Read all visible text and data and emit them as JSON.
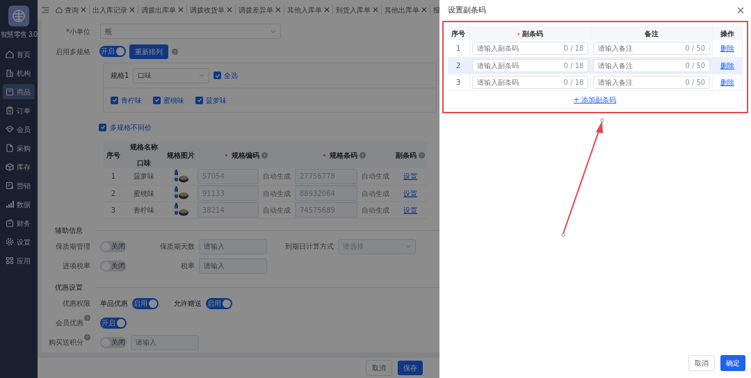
{
  "sidebar": {
    "logo_text": "智慧零售 3.0",
    "items": [
      {
        "label": "首页",
        "selected": false
      },
      {
        "label": "机构",
        "selected": false
      },
      {
        "label": "商品",
        "selected": true
      },
      {
        "label": "订单",
        "selected": false
      },
      {
        "label": "会员",
        "selected": false
      },
      {
        "label": "采购",
        "selected": false
      },
      {
        "label": "库存",
        "selected": false
      },
      {
        "label": "营销",
        "selected": false
      },
      {
        "label": "数据",
        "selected": false
      },
      {
        "label": "财务",
        "selected": false
      },
      {
        "label": "设置",
        "selected": false
      },
      {
        "label": "应用",
        "selected": false
      }
    ]
  },
  "tabs": [
    {
      "label": "查询",
      "kind": "home",
      "closable": true
    },
    {
      "label": "出入库记录",
      "kind": "plain",
      "closable": true
    },
    {
      "label": "调拨出库单",
      "kind": "plain",
      "closable": true
    },
    {
      "label": "调拨收货单",
      "kind": "plain",
      "closable": true
    },
    {
      "label": "调拨差异单",
      "kind": "plain",
      "closable": true
    },
    {
      "label": "其他入库单",
      "kind": "plain",
      "closable": true
    },
    {
      "label": "到货入库单",
      "kind": "plain",
      "closable": true
    },
    {
      "label": "其他出库单",
      "kind": "plain",
      "closable": true
    },
    {
      "label": "报",
      "kind": "plain",
      "closable": false
    }
  ],
  "form": {
    "unit": {
      "label": "*小单位",
      "value": "瓶"
    },
    "multi_spec": {
      "label": "启用多规格",
      "switch": {
        "on": true,
        "text": "开启"
      },
      "button": "重新排列"
    },
    "spec_group": {
      "label": "规格1",
      "select": "口味",
      "select_all": {
        "label": "全选",
        "checked": true
      },
      "options": [
        {
          "label": "青柠味",
          "checked": true
        },
        {
          "label": "蜜桃味",
          "checked": true
        },
        {
          "label": "菠萝味",
          "checked": true
        }
      ]
    },
    "diff_price": {
      "label": "多规格不同价",
      "checked": true
    },
    "spec_table": {
      "columns": [
        {
          "label": "序号"
        },
        {
          "label": "规格名称",
          "sub": "口味"
        },
        {
          "label": "规格图片"
        },
        {
          "label": "规格编码",
          "required": true,
          "help": true
        },
        {
          "label": "规格条码",
          "required": true,
          "help": true
        },
        {
          "label": "副条码",
          "help": true
        }
      ],
      "rows": [
        {
          "index": "1",
          "name": "菠萝味",
          "code": "57054",
          "code_hint": "自动生成",
          "barcode": "27756778",
          "barcode_hint": "自动生成",
          "action": "设置"
        },
        {
          "index": "2",
          "name": "蜜桃味",
          "code": "91133",
          "code_hint": "自动生成",
          "barcode": "88932064",
          "barcode_hint": "自动生成",
          "action": "设置"
        },
        {
          "index": "3",
          "name": "青柠味",
          "code": "38214",
          "code_hint": "自动生成",
          "barcode": "74575689",
          "barcode_hint": "自动生成",
          "action": "设置"
        }
      ]
    },
    "aux": {
      "title": "辅助信息",
      "rows": [
        [
          {
            "kind": "switch",
            "label": "保质期管理",
            "on": false,
            "text": "关闭"
          },
          {
            "kind": "input",
            "label": "保质期天数",
            "placeholder": "请输入"
          },
          {
            "kind": "select",
            "label": "到期日计算方式",
            "placeholder": "请选择"
          }
        ],
        [
          {
            "kind": "switch",
            "label": "进项税率",
            "on": false,
            "text": "关闭"
          },
          {
            "kind": "input",
            "label": "税率",
            "placeholder": "请输入"
          }
        ]
      ]
    },
    "discount": {
      "title": "优惠设置",
      "rows": [
        {
          "label": "优惠权限",
          "help": false,
          "items": [
            {
              "kind": "switch",
              "label": "单品优惠",
              "on": true,
              "text": "启用"
            },
            {
              "kind": "switch",
              "label": "允许赠送",
              "on": true,
              "text": "启用"
            }
          ]
        },
        {
          "label": "会员优惠",
          "help": true,
          "items": [
            {
              "kind": "switch",
              "on": true,
              "text": "开启"
            }
          ]
        },
        {
          "label": "购买送积分",
          "help": true,
          "items": [
            {
              "kind": "switch",
              "on": false,
              "text": "关闭"
            },
            {
              "kind": "input",
              "placeholder": "请输入"
            }
          ]
        }
      ]
    },
    "buttons": [
      {
        "label": "取消",
        "kind": "default"
      },
      {
        "label": "保存",
        "kind": "primary"
      }
    ]
  },
  "drawer": {
    "title": "设置副条码",
    "columns": [
      {
        "label": "序号",
        "required": false
      },
      {
        "label": "副条码",
        "required": true
      },
      {
        "label": "备注",
        "required": false
      },
      {
        "label": "操作",
        "required": false
      }
    ],
    "rows": [
      {
        "index": "1",
        "hovered": false,
        "code": {
          "placeholder": "请输入副条码",
          "counter": "0 / 18"
        },
        "note": {
          "placeholder": "请输入备注",
          "counter": "0 / 50"
        },
        "action": "删除"
      },
      {
        "index": "2",
        "hovered": true,
        "code": {
          "placeholder": "请输入副条码",
          "counter": "0 / 18"
        },
        "note": {
          "placeholder": "请输入备注",
          "counter": "0 / 50"
        },
        "action": "删除"
      },
      {
        "index": "3",
        "hovered": false,
        "code": {
          "placeholder": "请输入副条码",
          "counter": "0 / 18"
        },
        "note": {
          "placeholder": "请输入备注",
          "counter": "0 / 50"
        },
        "action": "删除"
      }
    ],
    "add": "+ 添加副条码",
    "buttons": [
      {
        "label": "取消",
        "kind": "default"
      },
      {
        "label": "确定",
        "kind": "primary"
      }
    ]
  }
}
